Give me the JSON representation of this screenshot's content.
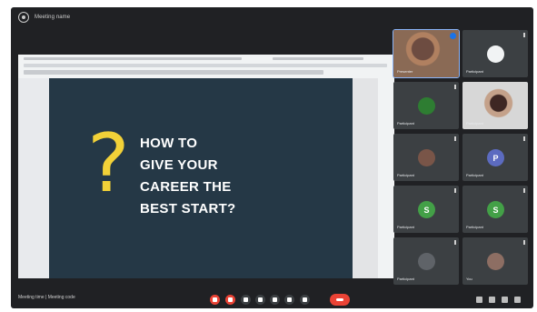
{
  "window": {
    "title": "Meeting name"
  },
  "presentation": {
    "slide_lines": [
      "HOW TO",
      "GIVE YOUR",
      "CAREER THE",
      "BEST START?"
    ],
    "symbol": "?"
  },
  "participants": [
    {
      "name": "Presenter",
      "type": "video"
    },
    {
      "name": "Participant",
      "type": "avatar",
      "initial": "",
      "color": "#f1f3f4"
    },
    {
      "name": "Participant",
      "type": "avatar",
      "initial": "",
      "color": "#2e7d32"
    },
    {
      "name": "Participant",
      "type": "video"
    },
    {
      "name": "Participant",
      "type": "avatar",
      "initial": "",
      "color": "#795548"
    },
    {
      "name": "Participant",
      "type": "avatar",
      "initial": "P",
      "color": "#5c6bc0"
    },
    {
      "name": "Participant",
      "type": "avatar",
      "initial": "S",
      "color": "#43a047"
    },
    {
      "name": "Participant",
      "type": "avatar",
      "initial": "S",
      "color": "#43a047"
    },
    {
      "name": "Participant",
      "type": "avatar",
      "initial": "",
      "color": "#5f6368"
    },
    {
      "name": "You",
      "type": "avatar",
      "initial": "",
      "color": "#8d6e63"
    }
  ],
  "bottom": {
    "meeting_info": "Meeting time | Meeting code"
  },
  "colors": {
    "bg": "#202124",
    "slide_bg": "#253846",
    "accent_yellow": "#f2d138",
    "end_call": "#ea4335"
  }
}
